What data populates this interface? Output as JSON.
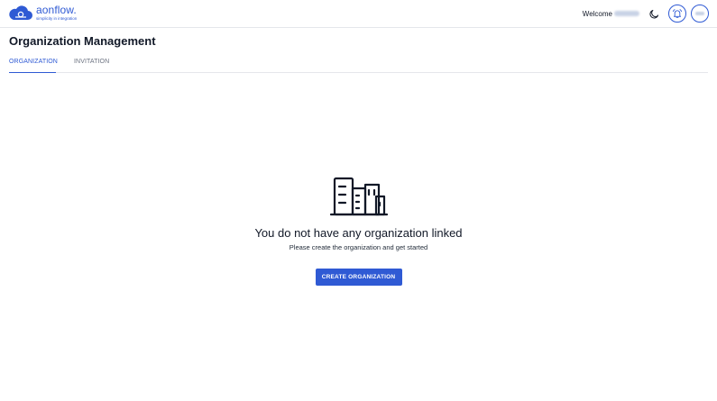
{
  "brand": {
    "name": "aonflow.",
    "tagline": "simplicity in integration",
    "accent_color": "#2f5ad4"
  },
  "header": {
    "welcome_label": "Welcome",
    "icons": {
      "theme_toggle": "moon-icon",
      "notifications": "alarm-bell-icon",
      "profile": "avatar"
    }
  },
  "page": {
    "title": "Organization Management"
  },
  "tabs": [
    {
      "label": "ORGANIZATION",
      "active": true
    },
    {
      "label": "INVITATION",
      "active": false
    }
  ],
  "empty_state": {
    "icon": "buildings-icon",
    "title": "You do not have any organization linked",
    "subtitle": "Please create the organization and get started",
    "button_label": "CREATE ORGANIZATION"
  }
}
